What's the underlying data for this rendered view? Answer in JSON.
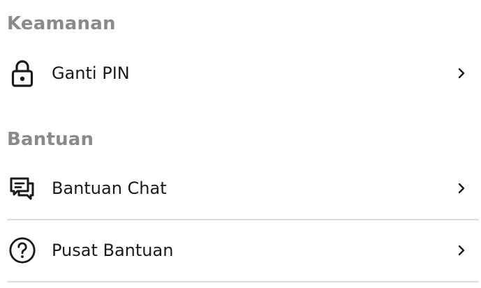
{
  "sections": [
    {
      "title": "Keamanan",
      "items": [
        {
          "label": "Ganti PIN",
          "icon": "lock-icon"
        }
      ]
    },
    {
      "title": "Bantuan",
      "items": [
        {
          "label": "Bantuan Chat",
          "icon": "chat-bubbles-icon"
        },
        {
          "label": "Pusat Bantuan",
          "icon": "question-circle-icon"
        }
      ]
    }
  ],
  "colors": {
    "section_title": "#8a8a8a",
    "text": "#1a1a1a",
    "divider": "#dddddd"
  }
}
